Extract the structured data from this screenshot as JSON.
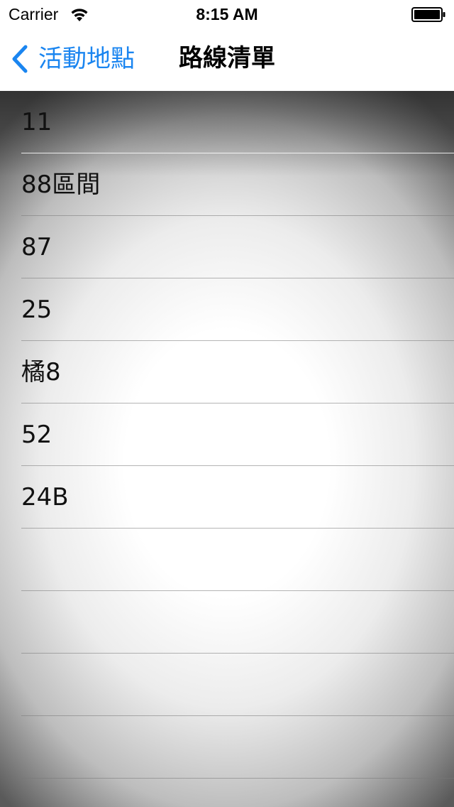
{
  "status_bar": {
    "carrier": "Carrier",
    "time": "8:15 AM",
    "wifi_icon": "wifi-icon",
    "battery_icon": "battery-icon"
  },
  "nav_bar": {
    "back_label": "活動地點",
    "title": "路線清單",
    "accent_color": "#1a85f0"
  },
  "routes": [
    {
      "label": "11"
    },
    {
      "label": "88區間"
    },
    {
      "label": "87"
    },
    {
      "label": "25"
    },
    {
      "label": "橘8"
    },
    {
      "label": "52"
    },
    {
      "label": "24B"
    },
    {
      "label": ""
    },
    {
      "label": ""
    },
    {
      "label": ""
    },
    {
      "label": ""
    },
    {
      "label": ""
    }
  ]
}
